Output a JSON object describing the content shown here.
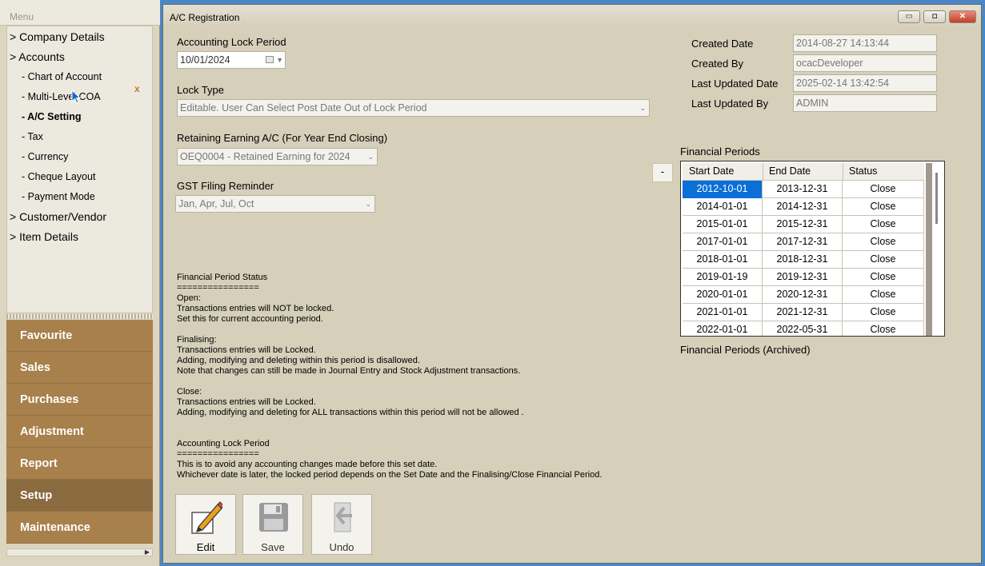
{
  "menu": {
    "title": "Menu",
    "tree": [
      {
        "label": "> Company Details",
        "level": 0
      },
      {
        "label": "> Accounts",
        "level": 0
      },
      {
        "label": "- Chart of Account",
        "level": 1
      },
      {
        "label": "- Multi-Level COA",
        "level": 1
      },
      {
        "label": "- A/C Setting",
        "level": 1,
        "active": true
      },
      {
        "label": "- Tax",
        "level": 1
      },
      {
        "label": "- Currency",
        "level": 1
      },
      {
        "label": "- Cheque Layout",
        "level": 1
      },
      {
        "label": "- Payment Mode",
        "level": 1
      },
      {
        "label": "> Customer/Vendor",
        "level": 0
      },
      {
        "label": "> Item Details",
        "level": 0
      }
    ],
    "close_mark": "x",
    "nav": [
      "Favourite",
      "Sales",
      "Purchases",
      "Adjustment",
      "Report",
      "Setup",
      "Maintenance"
    ],
    "nav_selected": "Setup"
  },
  "window": {
    "title": "A/C Registration",
    "buttons": {
      "minimize": "▭",
      "maximize": "◘",
      "close": "✕"
    }
  },
  "form": {
    "lock_period_label": "Accounting Lock Period",
    "lock_period_value": "10/01/2024",
    "lock_type_label": "Lock Type",
    "lock_type_value": "Editable. User Can Select Post Date Out of Lock Period",
    "retaining_label": "Retaining Earning A/C (For Year End Closing)",
    "retaining_value": "OEQ0004 - Retained Earning for 2024",
    "gst_label": "GST Filing Reminder",
    "gst_value": "Jan, Apr, Jul, Oct"
  },
  "meta": {
    "created_date_label": "Created Date",
    "created_date": "2014-08-27 14:13:44",
    "created_by_label": "Created By",
    "created_by": "ocacDeveloper",
    "updated_date_label": "Last Updated Date",
    "updated_date": "2025-02-14 13:42:54",
    "updated_by_label": "Last Updated By",
    "updated_by": "ADMIN"
  },
  "info_text": "Financial Period Status\n================\nOpen:\nTransactions entries will NOT be locked.\nSet this for current accounting period.\n\nFinalising:\nTransactions entries will be Locked.\nAdding, modifying and deleting within this period is disallowed.\nNote that changes can still be made in Journal Entry and Stock Adjustment transactions.\n\nClose:\nTransactions entries will be Locked.\nAdding, modifying and deleting for ALL transactions within this period will not be allowed .\n\n\nAccounting Lock Period\n================\nThis is to avoid any accounting changes made before this set date.\nWhichever date is later, the locked period depends on the Set Date and the Finalising/Close Financial Period.",
  "periods": {
    "title": "Financial Periods",
    "archived_label": "Financial Periods (Archived)",
    "minus_label": "-",
    "columns": [
      "Start Date",
      "End Date",
      "Status"
    ],
    "rows": [
      [
        "2012-10-01",
        "2013-12-31",
        "Close"
      ],
      [
        "2014-01-01",
        "2014-12-31",
        "Close"
      ],
      [
        "2015-01-01",
        "2015-12-31",
        "Close"
      ],
      [
        "2017-01-01",
        "2017-12-31",
        "Close"
      ],
      [
        "2018-01-01",
        "2018-12-31",
        "Close"
      ],
      [
        "2019-01-19",
        "2019-12-31",
        "Close"
      ],
      [
        "2020-01-01",
        "2020-12-31",
        "Close"
      ],
      [
        "2021-01-01",
        "2021-12-31",
        "Close"
      ],
      [
        "2022-01-01",
        "2022-05-31",
        "Close"
      ]
    ]
  },
  "toolbar": {
    "edit": "Edit",
    "save": "Save",
    "undo": "Undo"
  }
}
